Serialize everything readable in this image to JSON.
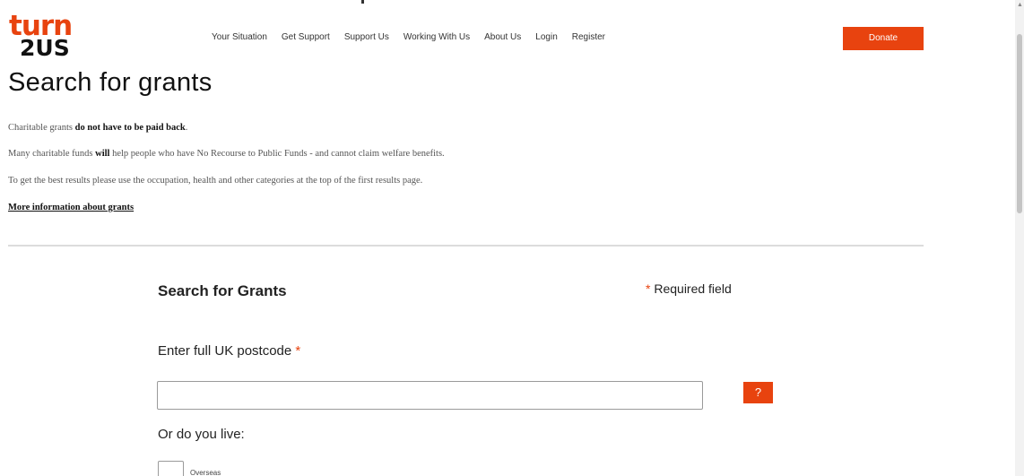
{
  "brand": {
    "logo_line1": "turn",
    "logo_line2": "2US",
    "accent_color": "#e8430f"
  },
  "nav": {
    "items": [
      "Your Situation",
      "Get Support",
      "Support Us",
      "Working With Us",
      "About Us",
      "Login",
      "Register"
    ],
    "donate_label": "Donate"
  },
  "page": {
    "title": "Search for grants"
  },
  "intro": {
    "p1_prefix": "Charitable grants ",
    "p1_bold": "do not have to be paid back",
    "p1_suffix": ".",
    "p2_prefix": "Many charitable funds ",
    "p2_bold": "will",
    "p2_suffix": " help people who have No Recourse to Public Funds - and cannot claim welfare benefits.",
    "p3": "To get the best results please use the occupation, health and other categories at the top of the first results page.",
    "more_link": "More information about grants"
  },
  "form": {
    "title": "Search for Grants",
    "required_star": "*",
    "required_note": "Required field",
    "postcode_label": "Enter full UK postcode",
    "postcode_star": "*",
    "postcode_value": "",
    "help_label": "?",
    "live_label": "Or do you live:",
    "overseas_label": "Overseas"
  }
}
